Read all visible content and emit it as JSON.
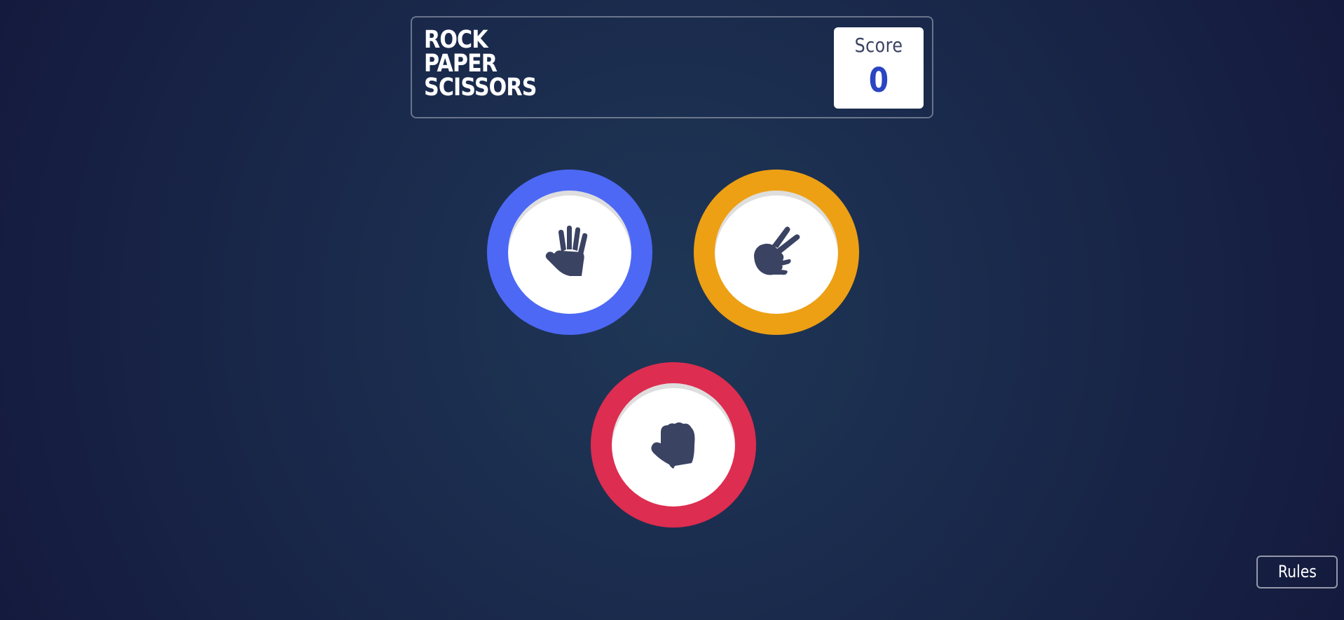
{
  "header": {
    "title_lines": [
      "ROCK",
      "PAPER",
      "SCISSORS"
    ],
    "score_label": "Score",
    "score_value": "0"
  },
  "tokens": [
    {
      "name": "paper",
      "icon": "paper-hand-icon",
      "ring_color": "#4d68f5"
    },
    {
      "name": "scissors",
      "icon": "scissors-hand-icon",
      "ring_color": "#eda014"
    },
    {
      "name": "rock",
      "icon": "rock-fist-icon",
      "ring_color": "#dd2d50"
    }
  ],
  "rules_button": {
    "label": "Rules"
  },
  "colors": {
    "background": "#1a2a4c",
    "icon": "#3b4363",
    "score_value": "#2a45c2"
  }
}
